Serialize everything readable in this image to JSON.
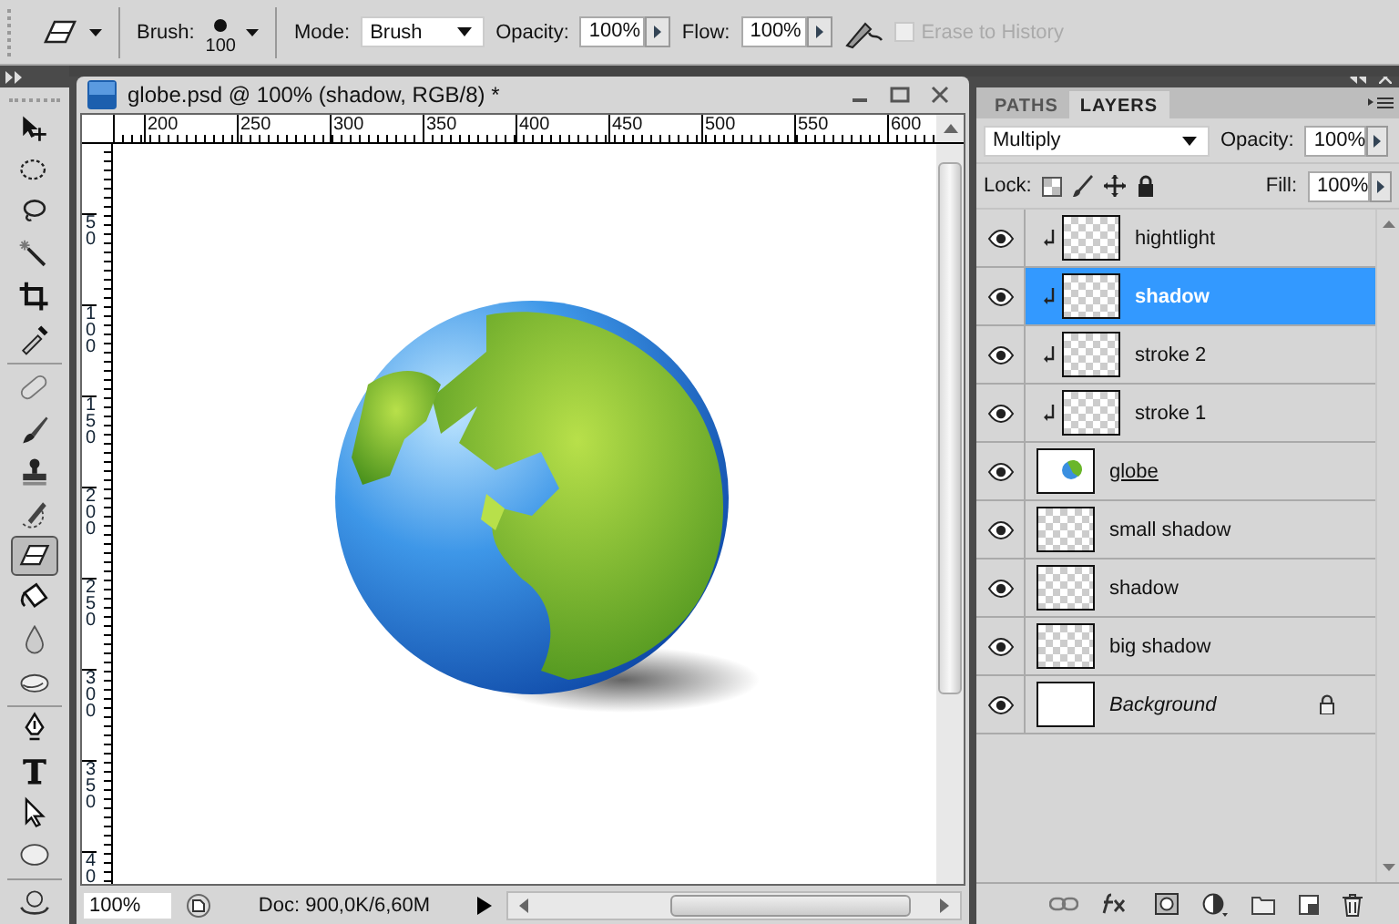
{
  "options_bar": {
    "brush_label": "Brush:",
    "brush_size": "100",
    "mode_label": "Mode:",
    "mode_value": "Brush",
    "opacity_label": "Opacity:",
    "opacity_value": "100%",
    "flow_label": "Flow:",
    "flow_value": "100%",
    "erase_to_history": {
      "label": "Erase to History",
      "checked": false,
      "disabled": true
    }
  },
  "tools": [
    {
      "kind": "move",
      "selected": false
    },
    {
      "kind": "marquee",
      "selected": false
    },
    {
      "kind": "lasso",
      "selected": false
    },
    {
      "kind": "wand",
      "selected": false
    },
    {
      "kind": "crop",
      "selected": false
    },
    {
      "kind": "eyedropper",
      "selected": false
    },
    {
      "kind": "heal",
      "selected": false
    },
    {
      "kind": "brush",
      "selected": false
    },
    {
      "kind": "stamp",
      "selected": false
    },
    {
      "kind": "history",
      "selected": false
    },
    {
      "kind": "eraser",
      "selected": true
    },
    {
      "kind": "bucket",
      "selected": false
    },
    {
      "kind": "blur",
      "selected": false
    },
    {
      "kind": "dodge",
      "selected": false
    },
    {
      "kind": "pen",
      "selected": false
    },
    {
      "kind": "type",
      "selected": false
    },
    {
      "kind": "select",
      "selected": false
    },
    {
      "kind": "shape",
      "selected": false
    },
    {
      "kind": "rotate",
      "selected": false
    }
  ],
  "document": {
    "title": "globe.psd @ 100% (shadow, RGB/8) *",
    "h_ruler": [
      "200",
      "250",
      "300",
      "350",
      "400",
      "450",
      "500",
      "550",
      "600"
    ],
    "v_ruler": [
      "50",
      "100",
      "150",
      "200",
      "250",
      "300",
      "350",
      "400"
    ],
    "zoom": "100%",
    "doc_info": "Doc: 900,0K/6,60M"
  },
  "layers_panel": {
    "tabs": [
      {
        "label": "PATHS",
        "selected": false
      },
      {
        "label": "LAYERS",
        "selected": true
      }
    ],
    "blend_mode": "Multiply",
    "opacity_label": "Opacity:",
    "opacity_value": "100%",
    "lock_label": "Lock:",
    "fill_label": "Fill:",
    "fill_value": "100%",
    "layers": [
      {
        "name": "hightlight",
        "selected": false,
        "visible": true,
        "kind": "clipped"
      },
      {
        "name": "shadow",
        "selected": true,
        "visible": true,
        "kind": "clipped"
      },
      {
        "name": "stroke 2",
        "selected": false,
        "visible": true,
        "kind": "clipped"
      },
      {
        "name": "stroke 1",
        "selected": false,
        "visible": true,
        "kind": "clipped"
      },
      {
        "name": "globe",
        "selected": false,
        "visible": true,
        "kind": "styled"
      },
      {
        "name": "small shadow",
        "selected": false,
        "visible": true,
        "kind": "pixel"
      },
      {
        "name": "shadow",
        "selected": false,
        "visible": true,
        "kind": "pixel"
      },
      {
        "name": "big shadow",
        "selected": false,
        "visible": true,
        "kind": "pixel"
      },
      {
        "name": "Background",
        "selected": false,
        "visible": true,
        "kind": "background"
      }
    ]
  }
}
